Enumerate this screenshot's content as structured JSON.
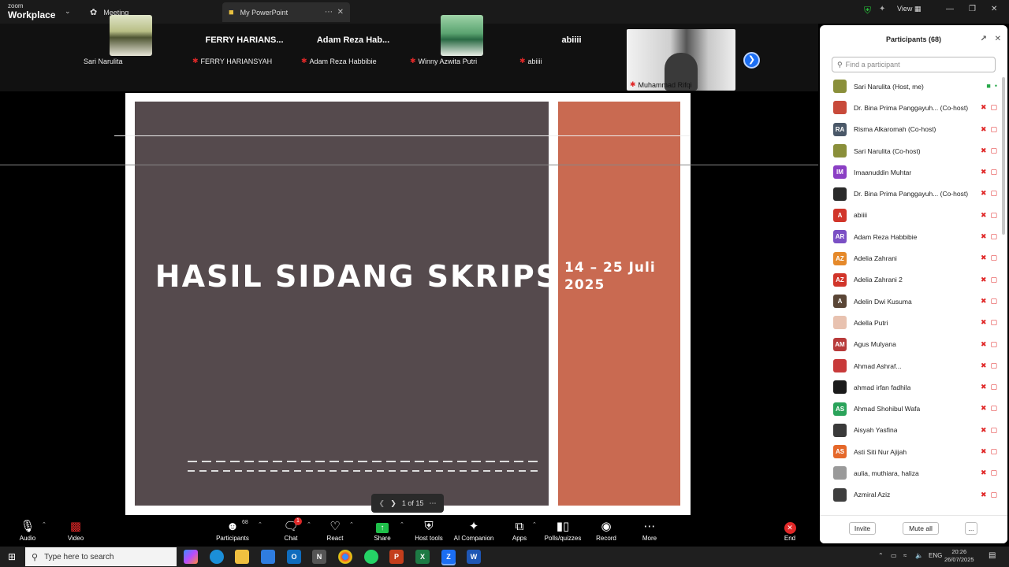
{
  "titlebar": {
    "brand_small": "zoom",
    "brand_big": "Workplace",
    "tabs": [
      {
        "label": "Meeting",
        "icon": "paw-icon"
      },
      {
        "label": "My PowerPoint",
        "icon": "app-icon"
      }
    ],
    "view_label": "View",
    "accent_shield": "#27c13a"
  },
  "gallery": {
    "tiles": [
      {
        "label": "Sari Narulita",
        "muted": false,
        "has_photo": true
      },
      {
        "big_name": "FERRY HARIANS...",
        "label": "FERRY HARIANSYAH",
        "muted": true
      },
      {
        "big_name": "Adam Reza Hab...",
        "label": "Adam Reza Habbibie",
        "muted": true
      },
      {
        "label": "Winny Azwita Putri",
        "muted": true,
        "has_photo": true
      },
      {
        "big_name": "abiiii",
        "label": "abiiii",
        "muted": true
      },
      {
        "label": "Muhammad Rifqi",
        "muted": true,
        "has_video": true
      }
    ]
  },
  "slide": {
    "title": "HASIL SIDANG SKRIPSI",
    "date": "14 – 25 Juli 2025",
    "left_color": "#554a4d",
    "right_color": "#c96a51",
    "page_indicator": "1 of 15"
  },
  "participants_panel": {
    "title": "Participants (68)",
    "search_placeholder": "Find a participant",
    "invite_label": "Invite",
    "mute_all_label": "Mute all",
    "more_label": "...",
    "rows": [
      {
        "initials": "",
        "name": "Sari Narulita (Host, me)",
        "color": "#8a8f3a",
        "photo": true
      },
      {
        "initials": "",
        "name": "Dr. Bina Prima Panggayuh... (Co-host)",
        "color": "#c84a3a",
        "photo": true
      },
      {
        "initials": "RA",
        "name": "Risma Alkaromah (Co-host)",
        "color": "#4a5868"
      },
      {
        "initials": "",
        "name": "Sari Narulita (Co-host)",
        "color": "#8a8f3a",
        "photo": true
      },
      {
        "initials": "IM",
        "name": "Imaanuddin Muhtar",
        "color": "#8b3fc4"
      },
      {
        "initials": "",
        "name": "Dr. Bina Prima Panggayuh... (Co-host)",
        "color": "#2a2a2a",
        "photo": true
      },
      {
        "initials": "A",
        "name": "abiiii",
        "color": "#d1352a"
      },
      {
        "initials": "AR",
        "name": "Adam Reza Habbibie",
        "color": "#7a4fc4"
      },
      {
        "initials": "AZ",
        "name": "Adelia Zahrani",
        "color": "#e5892a"
      },
      {
        "initials": "AZ",
        "name": "Adelia Zahrani 2",
        "color": "#d1352a"
      },
      {
        "initials": "A",
        "name": "Adelin Dwi Kusuma",
        "color": "#5a4636"
      },
      {
        "initials": "",
        "name": "Adella Putri",
        "color": "#e8c2b0",
        "photo": true
      },
      {
        "initials": "AM",
        "name": "Agus Mulyana",
        "color": "#b83a3a"
      },
      {
        "initials": "",
        "name": "Ahmad Ashraf...",
        "color": "#c83a3a"
      },
      {
        "initials": "",
        "name": "ahmad irfan fadhila",
        "color": "#1a1a1a",
        "photo": true
      },
      {
        "initials": "AS",
        "name": "Ahmad Shohibul Wafa",
        "color": "#2aa35a"
      },
      {
        "initials": "",
        "name": "Aisyah Yasfina",
        "color": "#3a3a3a",
        "photo": true
      },
      {
        "initials": "AS",
        "name": "Asti Siti Nur Ajijah",
        "color": "#e5682a"
      },
      {
        "initials": "",
        "name": "aulia, muthiara, haliza",
        "color": "#9a9a9a",
        "photo": true
      },
      {
        "initials": "",
        "name": "Azmiral Aziz",
        "color": "#3e3e3e",
        "photo": true
      }
    ]
  },
  "toolbar": {
    "audio": "Audio",
    "video": "Video",
    "participants": "Participants",
    "participants_count": "68",
    "chat": "Chat",
    "chat_badge": "1",
    "react": "React",
    "share": "Share",
    "host_tools": "Host tools",
    "ai_companion": "AI Companion",
    "apps": "Apps",
    "polls": "Polls/quizzes",
    "record": "Record",
    "more": "More",
    "end": "End",
    "share_color": "#1fbf4a",
    "end_color": "#e02828"
  },
  "taskbar": {
    "search_placeholder": "Type here to search",
    "lang": "ENG",
    "time": "20:26",
    "date": "26/07/2025"
  }
}
